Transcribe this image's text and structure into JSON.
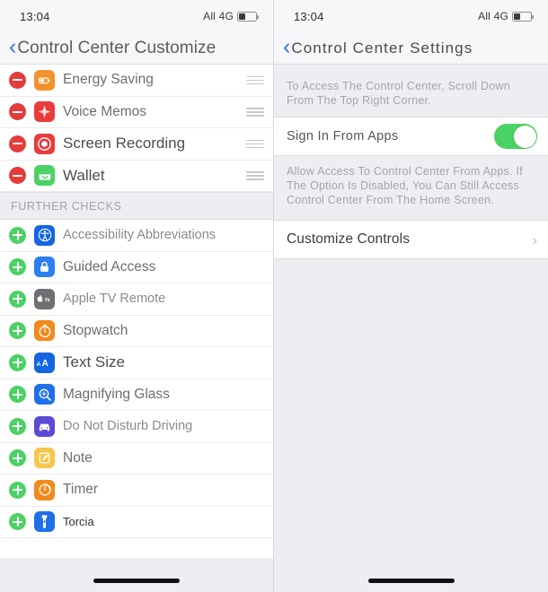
{
  "left": {
    "status": {
      "time": "13:04",
      "carrier": "All 4G"
    },
    "nav": {
      "back_icon": "chevron-left-icon",
      "title": "Control Center Customize"
    },
    "included": [
      {
        "label": "Energy Saving",
        "icon": "battery-icon",
        "color": "#f3922b",
        "style": "med",
        "badge": "remove"
      },
      {
        "label": "Voice Memos",
        "icon": "waveform-icon",
        "color": "#ea3b3b",
        "style": "med",
        "badge": "remove"
      },
      {
        "label": "Screen Recording",
        "icon": "record-circle-icon",
        "color": "#ea3b3b",
        "style": "big",
        "badge": "remove"
      },
      {
        "label": "Wallet",
        "icon": "wallet-icon",
        "color": "#4cd063",
        "style": "big",
        "badge": "remove"
      }
    ],
    "section_title": "FURTHER CHECKS",
    "available": [
      {
        "label": "Accessibility Abbreviations",
        "icon": "accessibility-icon",
        "color": "#1565e0",
        "style": "reg",
        "badge": "add"
      },
      {
        "label": "Guided Access",
        "icon": "lock-icon",
        "color": "#2d7ff0",
        "style": "med",
        "badge": "add"
      },
      {
        "label": "Apple TV Remote",
        "icon": "apple-tv-icon",
        "color": "#6e6e73",
        "style": "reg",
        "badge": "add"
      },
      {
        "label": "Stopwatch",
        "icon": "stopwatch-icon",
        "color": "#f08a1e",
        "style": "med",
        "badge": "add"
      },
      {
        "label": "Text Size",
        "icon": "text-size-icon",
        "color": "#1565e0",
        "style": "big",
        "badge": "add"
      },
      {
        "label": "Magnifying Glass",
        "icon": "magnifier-icon",
        "color": "#1e6fe8",
        "style": "med",
        "badge": "add"
      },
      {
        "label": "Do Not Disturb Driving",
        "icon": "car-icon",
        "color": "#5b4bd6",
        "style": "reg",
        "badge": "add"
      },
      {
        "label": "Note",
        "icon": "note-icon",
        "color": "#f7c64a",
        "style": "med",
        "badge": "add"
      },
      {
        "label": "Timer",
        "icon": "timer-icon",
        "color": "#f08a1e",
        "style": "med",
        "badge": "add"
      },
      {
        "label": "Torcia",
        "icon": "flashlight-icon",
        "color": "#1e6fe8",
        "style": "sml",
        "badge": "add"
      }
    ]
  },
  "right": {
    "status": {
      "time": "13:04",
      "carrier": "All 4G"
    },
    "nav": {
      "back_icon": "chevron-left-icon",
      "title": "Control Center Settings"
    },
    "top_footnote": "To Access The Control Center, Scroll Down From The Top Right Corner.",
    "toggle_row": {
      "label": "Sign In From Apps",
      "state": "on"
    },
    "bottom_footnote": "Allow Access To Control Center From Apps. If The Option Is Disabled, You Can Still Access Control Center From The Home Screen.",
    "link_row": {
      "label": "Customize Controls",
      "disclosure": "chevron-right-icon"
    }
  },
  "colors": {
    "accent_blue": "#2b7ae4",
    "toggle_green": "#4ad264",
    "remove_red": "#e43b3b",
    "add_green": "#4cd164"
  }
}
